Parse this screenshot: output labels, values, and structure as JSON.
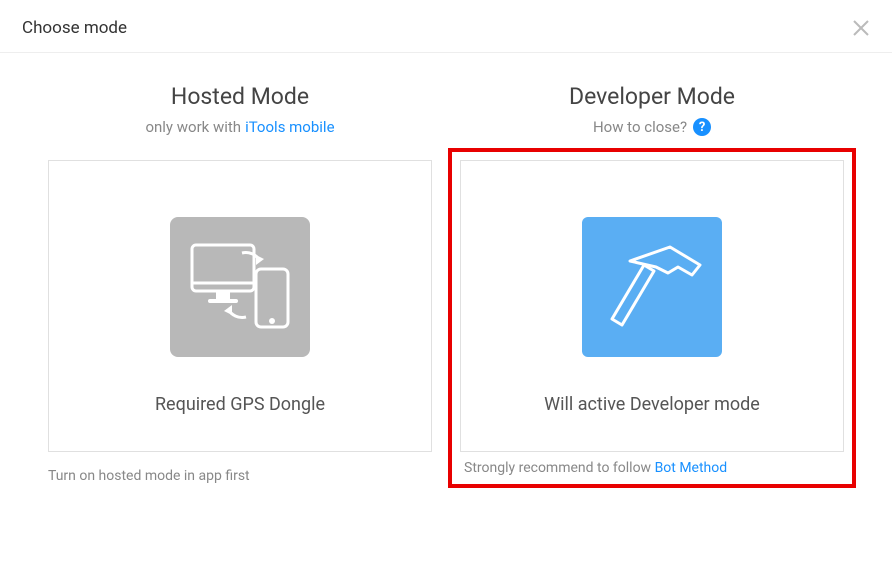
{
  "header": {
    "title": "Choose mode"
  },
  "hosted": {
    "title": "Hosted Mode",
    "subtitle_prefix": "only work with",
    "subtitle_link": "iTools mobile",
    "card_label": "Required GPS Dongle",
    "footer": "Turn on hosted mode in app first"
  },
  "developer": {
    "title": "Developer Mode",
    "subtitle": "How to close?",
    "card_label": "Will active Developer mode",
    "footer_prefix": "Strongly recommend to follow",
    "footer_link": "Bot Method"
  },
  "colors": {
    "accent": "#1890ff",
    "highlight": "#e80000",
    "gray_icon": "#b8b8b8",
    "blue_tile": "#5aaef3"
  }
}
